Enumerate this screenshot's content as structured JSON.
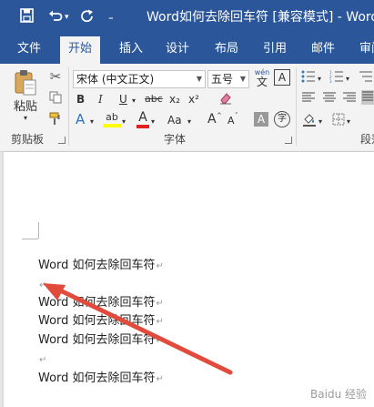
{
  "titlebar": {
    "title": "Word如何去除回车符 [兼容模式] - Word",
    "icons": [
      "save-icon",
      "undo-icon",
      "undo-dropdown-icon",
      "redo-icon",
      "customize-toolbar-icon"
    ],
    "color": "#2b579a"
  },
  "tabs": [
    "文件",
    "开始",
    "插入",
    "设计",
    "布局",
    "引用",
    "邮件",
    "审阅"
  ],
  "active_tab": "开始",
  "clipboard": {
    "paste_label": "粘贴",
    "group_label": "剪贴板"
  },
  "font": {
    "font_name": "宋体 (中文正文)",
    "font_size": "五号",
    "phonetic_guide": "wén",
    "enclosed_char": "A",
    "bold": "B",
    "italic": "I",
    "underline": "U",
    "strikethrough": "abc",
    "subscript": "x₂",
    "superscript": "x²",
    "text_effects": "A",
    "highlight": "ab",
    "font_color": "A",
    "change_case": "Aa",
    "grow_font": "A",
    "shrink_font": "A",
    "char_shading": "A",
    "enclosed": "字",
    "group_label": "字体"
  },
  "paragraph": {
    "group_label": "段落"
  },
  "document": {
    "lines": [
      {
        "text": "Word 如何去除回车符",
        "mark": "↵"
      },
      {
        "text": "",
        "mark": "↵"
      },
      {
        "text": "Word 如何去除回车符",
        "mark": "↵"
      },
      {
        "text": "Word 如何去除回车符",
        "mark": "↵"
      },
      {
        "text": "Word 如何去除回车符",
        "mark": "↵"
      },
      {
        "text": "",
        "mark": "↵"
      },
      {
        "text": "Word 如何去除回车符",
        "mark": "↵"
      }
    ]
  },
  "annotation": {
    "arrow_color": "#e04b3c"
  },
  "watermark": "Baidu 经验"
}
